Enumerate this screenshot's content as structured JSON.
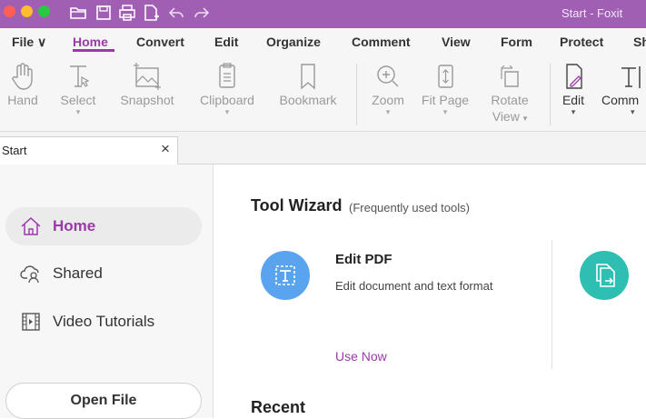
{
  "window": {
    "title": "Start - Foxit"
  },
  "colors": {
    "accent": "#9a3aa8",
    "titlebar": "#a05fb3",
    "edit_pdf_circle": "#5aa3ee",
    "second_tool_circle": "#2fbfb2"
  },
  "menu": {
    "items": [
      {
        "id": "file",
        "label": "File ∨"
      },
      {
        "id": "home",
        "label": "Home",
        "active": true
      },
      {
        "id": "convert",
        "label": "Convert"
      },
      {
        "id": "edit",
        "label": "Edit"
      },
      {
        "id": "organize",
        "label": "Organize"
      },
      {
        "id": "comment",
        "label": "Comment"
      },
      {
        "id": "view",
        "label": "View"
      },
      {
        "id": "form",
        "label": "Form"
      },
      {
        "id": "protect",
        "label": "Protect"
      },
      {
        "id": "share",
        "label": "Sh"
      }
    ]
  },
  "ribbon": {
    "tools": [
      {
        "id": "hand",
        "label": "Hand",
        "icon": "hand-icon"
      },
      {
        "id": "select",
        "label": "Select",
        "icon": "select-text-icon",
        "dropdown": true
      },
      {
        "id": "snapshot",
        "label": "Snapshot",
        "icon": "snapshot-icon"
      },
      {
        "id": "clipboard",
        "label": "Clipboard",
        "icon": "clipboard-icon",
        "dropdown": true
      },
      {
        "id": "bookmark",
        "label": "Bookmark",
        "icon": "bookmark-icon"
      },
      {
        "id": "zoom",
        "label": "Zoom",
        "icon": "zoom-in-icon",
        "dropdown": true
      },
      {
        "id": "fitpage",
        "label": "Fit Page",
        "icon": "fit-page-icon",
        "dropdown": true
      },
      {
        "id": "rotate",
        "label": "Rotate",
        "label2": "View",
        "icon": "rotate-view-icon",
        "dropdown": true
      },
      {
        "id": "edit",
        "label": "Edit",
        "icon": "edit-icon",
        "dropdown": true
      },
      {
        "id": "comment",
        "label": "Comm",
        "icon": "typewriter-icon",
        "dropdown": true
      }
    ]
  },
  "tab": {
    "label": "Start",
    "close": "×"
  },
  "sidebar": {
    "items": [
      {
        "id": "home",
        "label": "Home",
        "icon": "home-icon",
        "active": true
      },
      {
        "id": "shared",
        "label": "Shared",
        "icon": "shared-icon"
      },
      {
        "id": "video",
        "label": "Video Tutorials",
        "icon": "video-icon"
      }
    ],
    "open_file": "Open File"
  },
  "main": {
    "wizard_title": "Tool Wizard",
    "wizard_subtitle": "(Frequently used tools)",
    "card": {
      "title": "Edit PDF",
      "description": "Edit document and text format",
      "action": "Use Now",
      "icon": "edit-pdf-icon"
    },
    "second_card_icon": "convert-icon",
    "recent_title": "Recent"
  }
}
